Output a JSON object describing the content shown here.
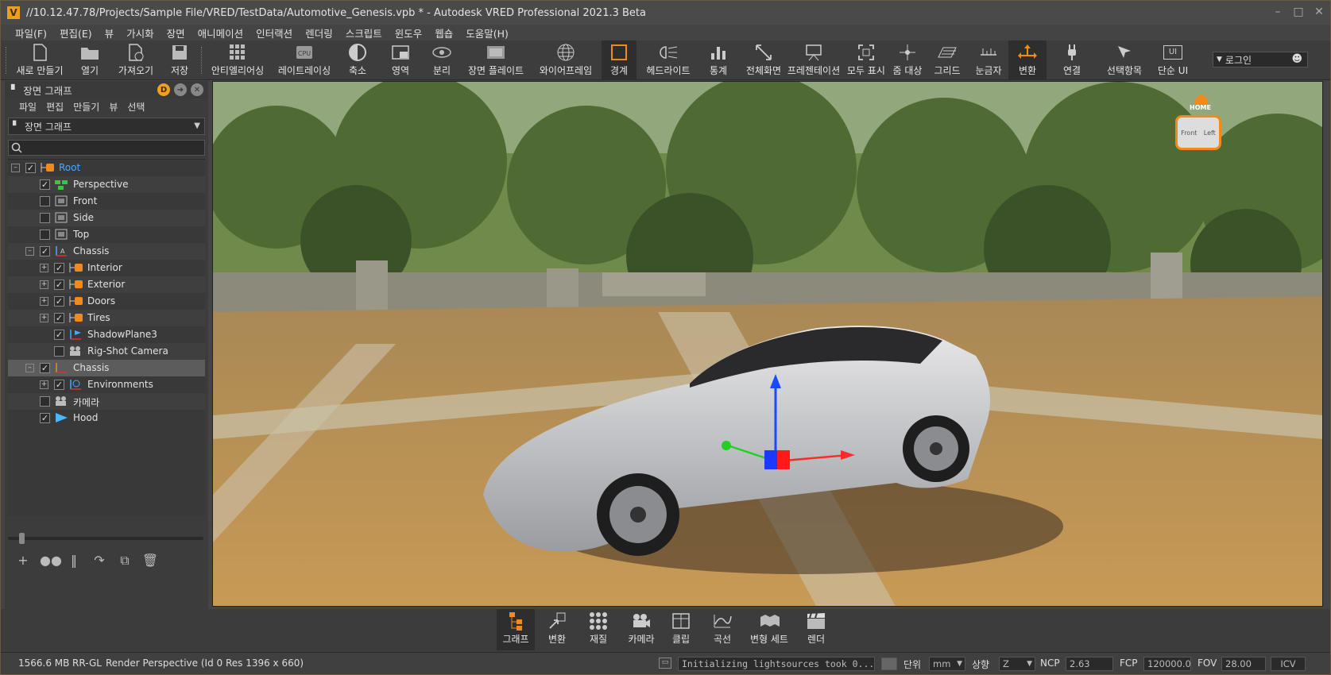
{
  "window": {
    "title": "//10.12.47.78/Projects/Sample File/VRED/TestData/Automotive_Genesis.vpb * - Autodesk VRED Professional 2021.3 Beta",
    "app_icon": "V"
  },
  "menu": [
    "파일(F)",
    "편집(E)",
    "뷰",
    "가시화",
    "장면",
    "애니메이션",
    "인터랙션",
    "렌더링",
    "스크립트",
    "윈도우",
    "웹숍",
    "도움말(H)"
  ],
  "toolbar": {
    "new": "새로 만들기",
    "open": "열기",
    "import": "가져오기",
    "save": "저장",
    "antialias": "안티엘리어싱",
    "raytracing": "레이트레이싱",
    "scale": "축소",
    "region": "영역",
    "separate": "분리",
    "scene_plate": "장면 플레이트",
    "wireframe": "와이어프레임",
    "boundary": "경계",
    "headlight": "헤드라이트",
    "stats": "통계",
    "fullscreen": "전체화면",
    "presentation": "프레젠테이션",
    "show_all": "모두 표시",
    "zoom_target": "줌 대상",
    "grid": "그리드",
    "ruler": "눈금자",
    "transform": "변환",
    "connect": "연결",
    "selection": "선택항목",
    "simple_ui": "단순 UI",
    "simple_ui_icon": "UI",
    "login": "로그인"
  },
  "panel": {
    "title": "장면 그래프",
    "menu": [
      "파일",
      "편집",
      "만들기",
      "뷰",
      "선택"
    ],
    "combo_value": "장면 그래프",
    "tree": [
      {
        "label": "Root",
        "checked": true
      },
      {
        "label": "Perspective",
        "checked": true
      },
      {
        "label": "Front",
        "checked": false
      },
      {
        "label": "Side",
        "checked": false
      },
      {
        "label": "Top",
        "checked": false
      },
      {
        "label": "Chassis",
        "checked": true
      },
      {
        "label": "Interior",
        "checked": true
      },
      {
        "label": "Exterior",
        "checked": true
      },
      {
        "label": "Doors",
        "checked": true
      },
      {
        "label": "Tires",
        "checked": true
      },
      {
        "label": "ShadowPlane3",
        "checked": true
      },
      {
        "label": "Rig-Shot Camera",
        "checked": false
      },
      {
        "label": "Chassis",
        "checked": true
      },
      {
        "label": "Environments",
        "checked": true
      },
      {
        "label": "카메라",
        "checked": false
      },
      {
        "label": "Hood",
        "checked": true
      }
    ]
  },
  "viewport": {
    "cube_home": "HOME",
    "cube_front": "Front",
    "cube_left": "Left"
  },
  "dock": {
    "graph": "그래프",
    "transform": "변환",
    "material": "재질",
    "camera": "카메라",
    "clip": "클립",
    "curve": "곡선",
    "variant_set": "변형 세트",
    "render": "렌더"
  },
  "status": {
    "memory": "1566.6 MB",
    "renderer": "RR-GL",
    "info": "Render Perspective (Id 0 Res 1396 x 660)",
    "message": "Initializing lightsources took 0...",
    "unit_label": "단위",
    "unit_value": "mm",
    "up_label": "상향",
    "up_value": "Z",
    "ncp_label": "NCP",
    "ncp_value": "2.63",
    "fcp_label": "FCP",
    "fcp_value": "120000.00",
    "fov_label": "FOV",
    "fov_value": "28.00",
    "icv": "ICV"
  },
  "colors": {
    "accent": "#f08a1c",
    "selected_row": "#5c5c5c",
    "root_text": "#4aa8ff"
  }
}
